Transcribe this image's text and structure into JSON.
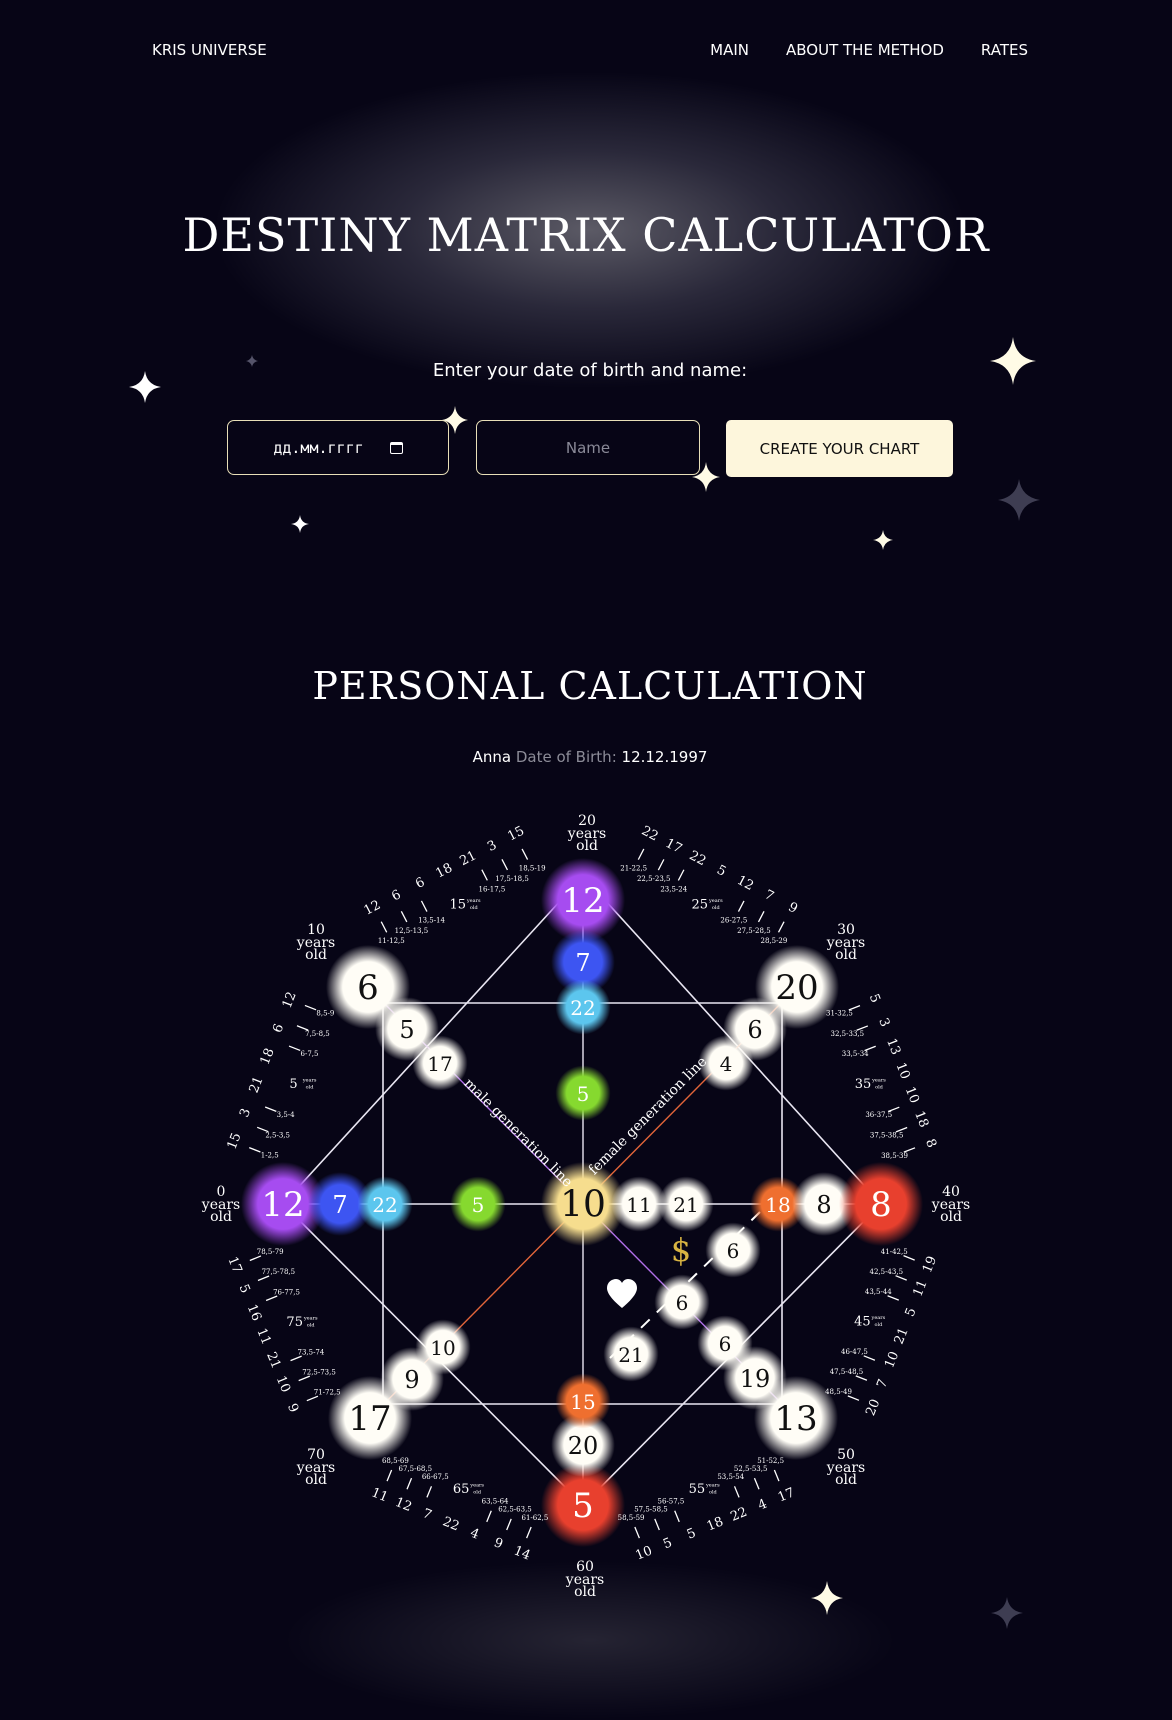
{
  "header": {
    "logo": "KRIS UNIVERSE",
    "nav": [
      "MAIN",
      "ABOUT THE METHOD",
      "RATES"
    ]
  },
  "hero": {
    "title": "DESTINY MATRIX CALCULATOR",
    "prompt": "Enter your date of birth and name:",
    "date_placeholder": "дд.мм.гггг",
    "name_placeholder": "Name",
    "button": "CREATE YOUR CHART"
  },
  "result": {
    "title": "PERSONAL CALCULATION",
    "name": "Anna",
    "dob_label": "Date of Birth:",
    "dob": "12.12.1997"
  },
  "matrix": {
    "outer": {
      "top": "12",
      "left": "12",
      "right": "8",
      "bottom": "5",
      "top_left": "6",
      "top_right": "20",
      "bottom_left": "17",
      "bottom_right": "13"
    },
    "top_line": [
      "7",
      "22",
      "5"
    ],
    "left_line": [
      "7",
      "22",
      "5"
    ],
    "center": "10",
    "right_line": [
      "11",
      "21",
      "18",
      "8"
    ],
    "bottom_line": [
      "15",
      "20"
    ],
    "tl_line": [
      "5",
      "17"
    ],
    "tr_line": [
      "6",
      "4"
    ],
    "bl_line": [
      "10",
      "9"
    ],
    "br_line": [
      "6",
      "19"
    ],
    "inner": [
      "6",
      "6",
      "21"
    ],
    "money_symbol": "$",
    "male_line": "male generation line",
    "female_line": "female generation line",
    "years_label": "years",
    "old_label": "old",
    "age_ticks": [
      "0",
      "10",
      "20",
      "30",
      "40",
      "50",
      "60",
      "70"
    ],
    "mid_ages": [
      "5",
      "15",
      "25",
      "35",
      "45",
      "55",
      "65",
      "75"
    ],
    "arcs": {
      "a0_10": {
        "nums": [
          "15",
          "3",
          "21",
          "18",
          "6",
          "12"
        ],
        "ranges": [
          "1-2,5",
          "2,5-3,5",
          "3,5-4",
          "6-7,5",
          "7,5-8,5",
          "8,5-9"
        ]
      },
      "a10_20": {
        "nums": [
          "12",
          "6",
          "6",
          "18",
          "21",
          "3",
          "15"
        ],
        "ranges": [
          "11-12,5",
          "12,5-13,5",
          "13,5-14",
          "16-17,5",
          "17,5-18,5",
          "18,5-19"
        ]
      },
      "a20_30": {
        "nums": [
          "22",
          "17",
          "22",
          "5",
          "12",
          "7",
          "9"
        ],
        "ranges": [
          "21-22,5",
          "22,5-23,5",
          "23,5-24",
          "26-27,5",
          "27,5-28,5",
          "28,5-29"
        ]
      },
      "a30_40": {
        "nums": [
          "5",
          "3",
          "13",
          "10",
          "10",
          "18",
          "8"
        ],
        "ranges": [
          "31-32,5",
          "32,5-33,5",
          "33,5-34",
          "36-37,5",
          "37,5-38,5",
          "38,5-39"
        ]
      },
      "a40_50": {
        "nums": [
          "19",
          "11",
          "5",
          "21",
          "10",
          "7",
          "20"
        ],
        "ranges": [
          "41-42,5",
          "42,5-43,5",
          "43,5-44",
          "46-47,5",
          "47,5-48,5",
          "48,5-49"
        ]
      },
      "a50_60": {
        "nums": [
          "17",
          "4",
          "22",
          "18",
          "5",
          "5",
          "10"
        ],
        "ranges": [
          "51-52,5",
          "52,5-53,5",
          "53,5-54",
          "56-57,5",
          "57,5-58,5",
          "58,5-59"
        ]
      },
      "a60_70": {
        "nums": [
          "14",
          "9",
          "4",
          "22",
          "7",
          "12",
          "11"
        ],
        "ranges": [
          "61-62,5",
          "62,5-63,5",
          "63,5-64",
          "66-67,5",
          "67,5-68,5",
          "68,5-69"
        ]
      },
      "a70_80": {
        "nums": [
          "9",
          "10",
          "21",
          "11",
          "16",
          "5",
          "17"
        ],
        "ranges": [
          "71-72,5",
          "72,5-73,5",
          "73,5-74",
          "76-77,5",
          "77,5-78,5",
          "78,5-79"
        ]
      }
    }
  },
  "colors": {
    "background": "#070516",
    "accent_button": "#fdf6dc",
    "violet": "#a64cf0",
    "blue": "#3d55f2",
    "cyan": "#5cc6ee",
    "green": "#86d92f",
    "yellow": "#f6dd8e",
    "orange": "#ef6f2f",
    "red": "#e8402e",
    "white": "#fffdf6",
    "gold": "#d8b442"
  }
}
